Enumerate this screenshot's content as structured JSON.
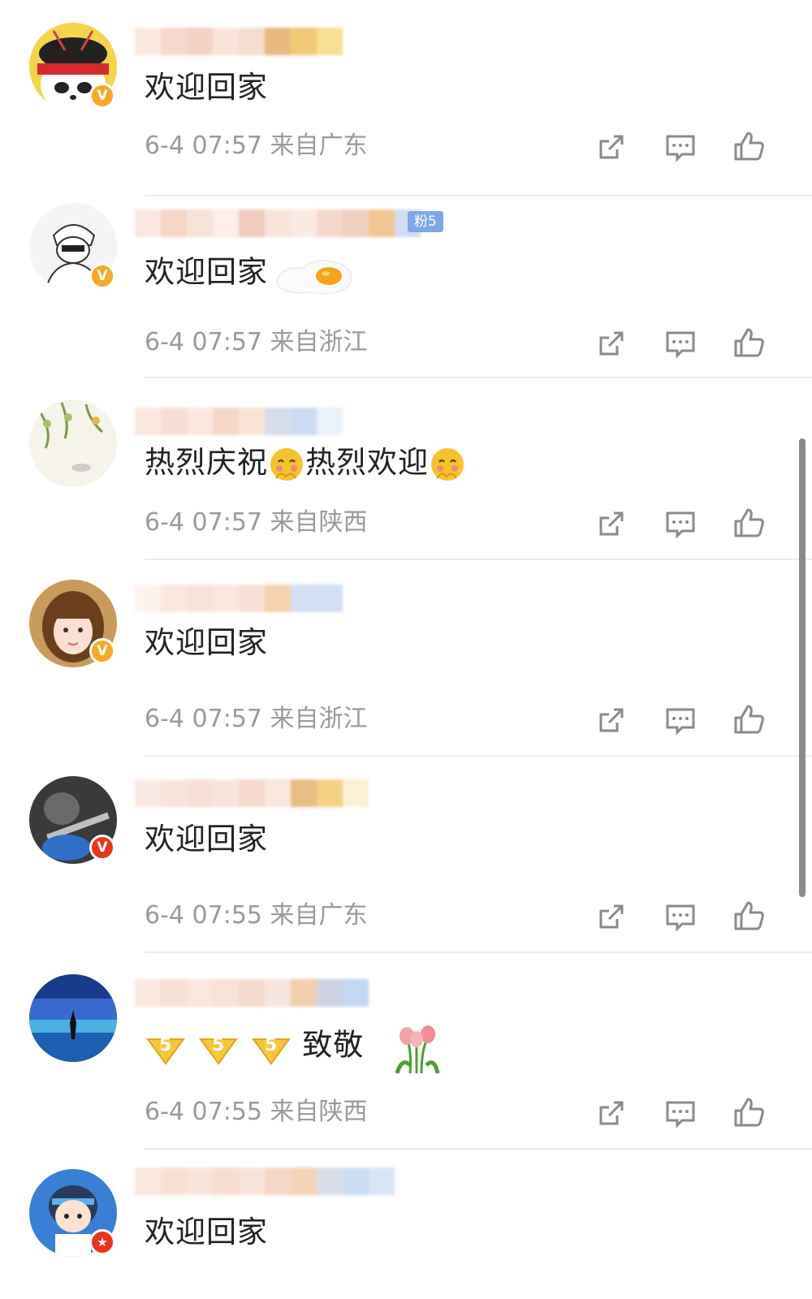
{
  "comments": [
    {
      "text": "欢迎回家",
      "time": "6-4 07:57",
      "location": "来自广东",
      "badge": "V",
      "badge_color": "#f7a925",
      "avatar": "panda-avatar",
      "fan_badge": ""
    },
    {
      "text": "欢迎回家",
      "time": "6-4 07:57",
      "location": "来自浙江",
      "badge": "V",
      "badge_color": "#f7a925",
      "avatar": "sketch-avatar",
      "fan_badge": "粉5"
    },
    {
      "text": "热烈庆祝",
      "text2": "热烈欢迎",
      "time": "6-4 07:57",
      "location": "来自陕西",
      "badge": "",
      "avatar": "flowers-avatar",
      "fan_badge": ""
    },
    {
      "text": "欢迎回家",
      "time": "6-4 07:57",
      "location": "来自浙江",
      "badge": "V",
      "badge_color": "#f7a925",
      "avatar": "girl-avatar",
      "fan_badge": ""
    },
    {
      "text": "欢迎回家",
      "time": "6-4 07:55",
      "location": "来自广东",
      "badge": "V",
      "badge_color": "#e8351d",
      "avatar": "sniper-avatar",
      "fan_badge": ""
    },
    {
      "text": "致敬",
      "time": "6-4 07:55",
      "location": "来自陕西",
      "badge": "",
      "avatar": "sea-avatar",
      "fan_badge": ""
    },
    {
      "text": "欢迎回家",
      "badge": "★",
      "badge_color": "#e8351d",
      "avatar": "cartoon-boy-avatar",
      "fan_badge": ""
    }
  ],
  "icons": {
    "share": "share-icon",
    "comment": "comment-icon",
    "like": "like-icon"
  },
  "colors": {
    "meta_text": "#9a9a9a",
    "vip_gold": "#f7a925",
    "vip_red": "#e8351d",
    "fan_badge": "#7ea6e8"
  }
}
